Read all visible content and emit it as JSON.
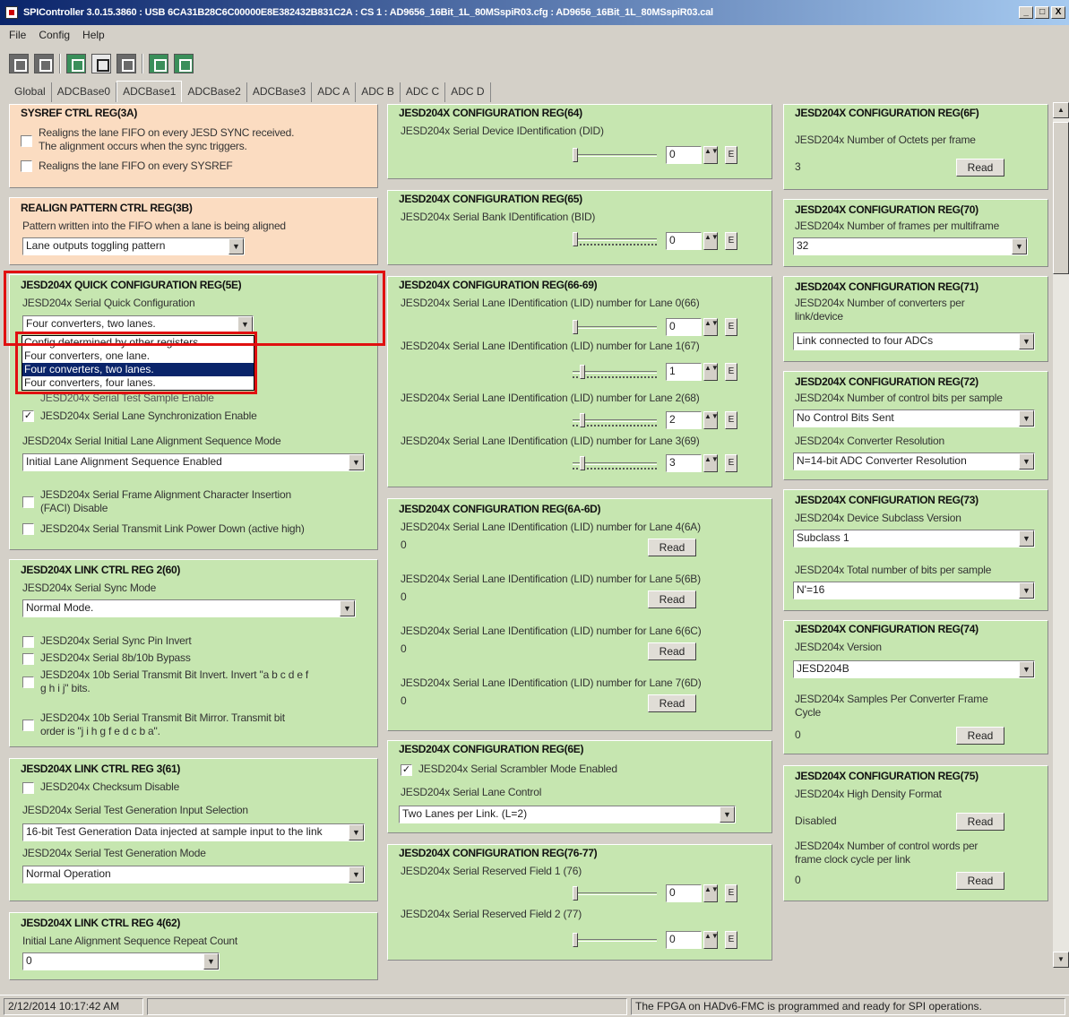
{
  "window": {
    "title": "SPIController 3.0.15.3860 : USB 6CA31B28C6C00000E8E382432B831C2A : CS 1 : AD9656_16Bit_1L_80MSspiR03.cfg : AD9656_16Bit_1L_80MSspiR03.cal",
    "min": "_",
    "max": "□",
    "close": "X"
  },
  "menu": [
    "File",
    "Config",
    "Help"
  ],
  "toolbar_icons": [
    "save-icon",
    "chip-icon",
    "run-icon",
    "window-icon",
    "grid-icon",
    "chart-icon",
    "image-icon"
  ],
  "tabs": [
    "Global",
    "ADCBase0",
    "ADCBase1",
    "ADCBase2",
    "ADCBase3",
    "ADC A",
    "ADC B",
    "ADC C",
    "ADC D"
  ],
  "active_tab": "ADCBase1",
  "common": {
    "read": "Read",
    "e": "E",
    "spin_up": "▲",
    "spin_dn": "▼",
    "combo_arrow": "▼"
  },
  "col1": {
    "sysref": {
      "title": "SYSREF CTRL REG(3A)",
      "cb1": "Realigns the lane FIFO on every JESD SYNC received.",
      "cb1b": "The alignment occurs when the sync triggers.",
      "cb2": "Realigns the lane FIFO on every SYSREF"
    },
    "realign": {
      "title": "REALIGN PATTERN CTRL REG(3B)",
      "desc": "Pattern written into the FIFO when a lane is being aligned",
      "value": "Lane outputs toggling pattern"
    },
    "quick": {
      "title": "JESD204X QUICK CONFIGURATION REG(5E)",
      "desc": "JESD204x Serial Quick Configuration",
      "value": "Four converters, two lanes.",
      "options": [
        "Config determined by other registers",
        "Four converters, one lane.",
        "Four converters, two lanes.",
        "Four converters, four lanes."
      ],
      "selected_index": 2,
      "hidden_cb": "JESD204x Serial Test Sample Enable",
      "cb_sync": "JESD204x Serial Lane Synchronization Enable",
      "ilas_label": "JESD204x Serial Initial Lane Alignment Sequence Mode",
      "ilas_value": "Initial Lane Alignment Sequence Enabled",
      "faci1": "JESD204x Serial Frame Alignment Character Insertion",
      "faci2": "(FACI) Disable",
      "pd": "JESD204x Serial Transmit Link Power Down (active high)"
    },
    "link2": {
      "title": "JESD204X LINK CTRL REG 2(60)",
      "sync_label": "JESD204x Serial Sync Mode",
      "sync_value": "Normal Mode.",
      "cb1": "JESD204x Serial Sync Pin Invert",
      "cb2": "JESD204x Serial 8b/10b Bypass",
      "cb3a": "JESD204x 10b Serial Transmit Bit Invert. Invert \"a b c d e f",
      "cb3b": "g h i j\" bits.",
      "cb4a": "JESD204x 10b Serial Transmit Bit Mirror. Transmit bit",
      "cb4b": "order is \"j i h g f e d c b a\"."
    },
    "link3": {
      "title": "JESD204X LINK CTRL REG 3(61)",
      "cb1": "JESD204x Checksum Disable",
      "tgsel_label": "JESD204x Serial Test Generation Input Selection",
      "tgsel_value": "16-bit Test Generation Data injected at sample input to the link",
      "tgmode_label": "JESD204x Serial Test Generation Mode",
      "tgmode_value": "Normal Operation"
    },
    "link4": {
      "title": "JESD204X LINK CTRL REG 4(62)",
      "label": "Initial Lane Alignment Sequence Repeat Count",
      "value": "0"
    }
  },
  "col2": {
    "r64": {
      "title": "JESD204X CONFIGURATION REG(64)",
      "desc": "JESD204x Serial Device IDentification (DID)",
      "value": "0"
    },
    "r65": {
      "title": "JESD204X CONFIGURATION REG(65)",
      "desc": "JESD204x Serial Bank IDentification (BID)",
      "value": "0"
    },
    "r66": {
      "title": "JESD204X CONFIGURATION REG(66-69)",
      "lanes": [
        {
          "label": "JESD204x Serial Lane IDentification (LID) number for Lane 0(66)",
          "value": "0"
        },
        {
          "label": "JESD204x Serial Lane IDentification (LID) number for Lane 1(67)",
          "value": "1"
        },
        {
          "label": "JESD204x Serial Lane IDentification (LID) number for Lane 2(68)",
          "value": "2"
        },
        {
          "label": "JESD204x Serial Lane IDentification (LID) number for Lane 3(69)",
          "value": "3"
        }
      ]
    },
    "r6a": {
      "title": "JESD204X CONFIGURATION REG(6A-6D)",
      "lanes": [
        {
          "label": "JESD204x Serial Lane IDentification (LID) number for Lane 4(6A)",
          "value": "0"
        },
        {
          "label": "JESD204x Serial Lane IDentification (LID) number for Lane 5(6B)",
          "value": "0"
        },
        {
          "label": "JESD204x Serial Lane IDentification (LID) number for Lane 6(6C)",
          "value": "0"
        },
        {
          "label": "JESD204x Serial Lane IDentification (LID) number for Lane 7(6D)",
          "value": "0"
        }
      ]
    },
    "r6e": {
      "title": "JESD204X CONFIGURATION REG(6E)",
      "cb": "JESD204x Serial Scrambler Mode Enabled",
      "lane_label": "JESD204x Serial Lane Control",
      "lane_value": "Two Lanes per Link.  (L=2)"
    },
    "r76": {
      "title": "JESD204X CONFIGURATION REG(76-77)",
      "f1": "JESD204x Serial Reserved Field 1 (76)",
      "v1": "0",
      "f2": "JESD204x Serial Reserved Field 2 (77)",
      "v2": "0"
    }
  },
  "col3": {
    "r6f": {
      "title": "JESD204X CONFIGURATION REG(6F)",
      "desc": "JESD204x Number of Octets per frame",
      "value": "3"
    },
    "r70": {
      "title": "JESD204X CONFIGURATION REG(70)",
      "desc": "JESD204x Number of frames per multiframe",
      "value": "32"
    },
    "r71": {
      "title": "JESD204X CONFIGURATION REG(71)",
      "desc1": "JESD204x Number of converters per",
      "desc2": "link/device",
      "value": "Link connected to four ADCs"
    },
    "r72": {
      "title": "JESD204X CONFIGURATION REG(72)",
      "desc": "JESD204x Number of control bits per sample",
      "value": "No Control Bits Sent",
      "res_label": "JESD204x Converter Resolution",
      "res_value": "N=14-bit ADC Converter Resolution"
    },
    "r73": {
      "title": "JESD204X CONFIGURATION REG(73)",
      "desc": "JESD204x Device Subclass Version",
      "value": "Subclass 1",
      "bits_label": "JESD204x Total number of bits per sample",
      "bits_value": "N'=16"
    },
    "r74": {
      "title": "JESD204X CONFIGURATION REG(74)",
      "desc": "JESD204x Version",
      "value": "JESD204B",
      "spc1": "JESD204x Samples Per Converter Frame",
      "spc2": "Cycle",
      "spc_value": "0"
    },
    "r75": {
      "title": "JESD204X CONFIGURATION REG(75)",
      "desc": "JESD204x High Density Format",
      "value": "Disabled",
      "cw1": "JESD204x Number of control words per",
      "cw2": "frame clock cycle per link",
      "cw_value": "0"
    }
  },
  "status": {
    "time": "2/12/2014 10:17:42 AM",
    "message": "The FPGA on HADv6-FMC is programmed and ready for SPI operations."
  },
  "colors": {
    "panel_green": "#c6e6b0",
    "panel_peach": "#fbdcc1",
    "highlight_red": "#e01010",
    "selection_blue": "#0a246a"
  }
}
